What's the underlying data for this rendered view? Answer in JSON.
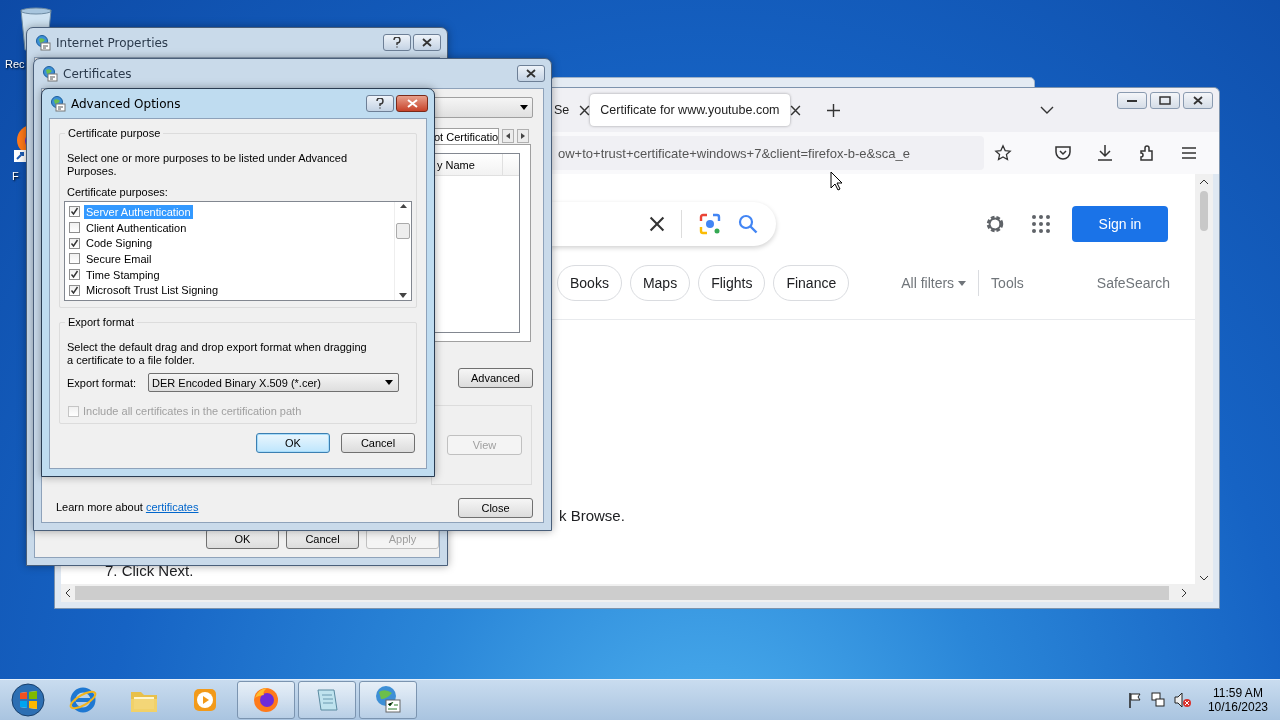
{
  "desktop": {
    "icons": [
      {
        "kind": "recycle-bin",
        "label": "Rec"
      },
      {
        "kind": "firefox",
        "label": "F"
      }
    ]
  },
  "browser": {
    "tabs": [
      {
        "label": "Se",
        "selected": false
      },
      {
        "label": "Certificate for www.youtube.com",
        "selected": true
      }
    ],
    "url": "ow+to+trust+certificate+windows+7&client=firefox-b-e&sca_e",
    "sign_in": "Sign in",
    "chips": [
      "Books",
      "Maps",
      "Flights",
      "Finance"
    ],
    "filters": {
      "all_filters": "All filters",
      "tools": "Tools",
      "safesearch": "SafeSearch"
    },
    "article_lines": [
      "k Browse.",
      "7. Click Next."
    ]
  },
  "internet_properties": {
    "title": "Internet Properties",
    "buttons": [
      {
        "label": "OK",
        "disabled": false
      },
      {
        "label": "Cancel",
        "disabled": false
      },
      {
        "label": "Apply",
        "disabled": true
      }
    ]
  },
  "certificates": {
    "title": "Certificates",
    "tab": "ot Certificatio",
    "column": "y Name",
    "advanced_button": "Advanced",
    "view_button": {
      "label": "View",
      "disabled": true
    },
    "learn_more": "Learn more about",
    "learn_link": "certificates",
    "close_button": "Close"
  },
  "advanced_options": {
    "title": "Advanced Options",
    "purpose_group": "Certificate purpose",
    "purpose_text": "Select one or more purposes to be listed under Advanced Purposes.",
    "purposes_label": "Certificate purposes:",
    "purposes": [
      {
        "label": "Server Authentication",
        "checked": true,
        "selected": true
      },
      {
        "label": "Client Authentication",
        "checked": false,
        "selected": false
      },
      {
        "label": "Code Signing",
        "checked": true,
        "selected": false
      },
      {
        "label": "Secure Email",
        "checked": false,
        "selected": false
      },
      {
        "label": "Time Stamping",
        "checked": true,
        "selected": false
      },
      {
        "label": "Microsoft Trust List Signing",
        "checked": true,
        "selected": false
      }
    ],
    "export_group": "Export format",
    "export_text": "Select the default drag and drop export format when dragging a certificate to a file folder.",
    "export_label": "Export format:",
    "export_value": "DER Encoded Binary X.509 (*.cer)",
    "include_all": {
      "label": "Include all certificates in the certification path",
      "checked": false,
      "disabled": true
    },
    "buttons": [
      {
        "label": "OK",
        "default": true
      },
      {
        "label": "Cancel",
        "default": false
      }
    ]
  },
  "taskbar": {
    "apps": [
      {
        "kind": "ie",
        "open": false
      },
      {
        "kind": "folder",
        "open": false
      },
      {
        "kind": "media",
        "open": false
      },
      {
        "kind": "firefox",
        "open": true
      },
      {
        "kind": "notepad",
        "open": true
      },
      {
        "kind": "certmgr",
        "open": true
      }
    ],
    "time": "11:59 AM",
    "date": "10/16/2023"
  }
}
